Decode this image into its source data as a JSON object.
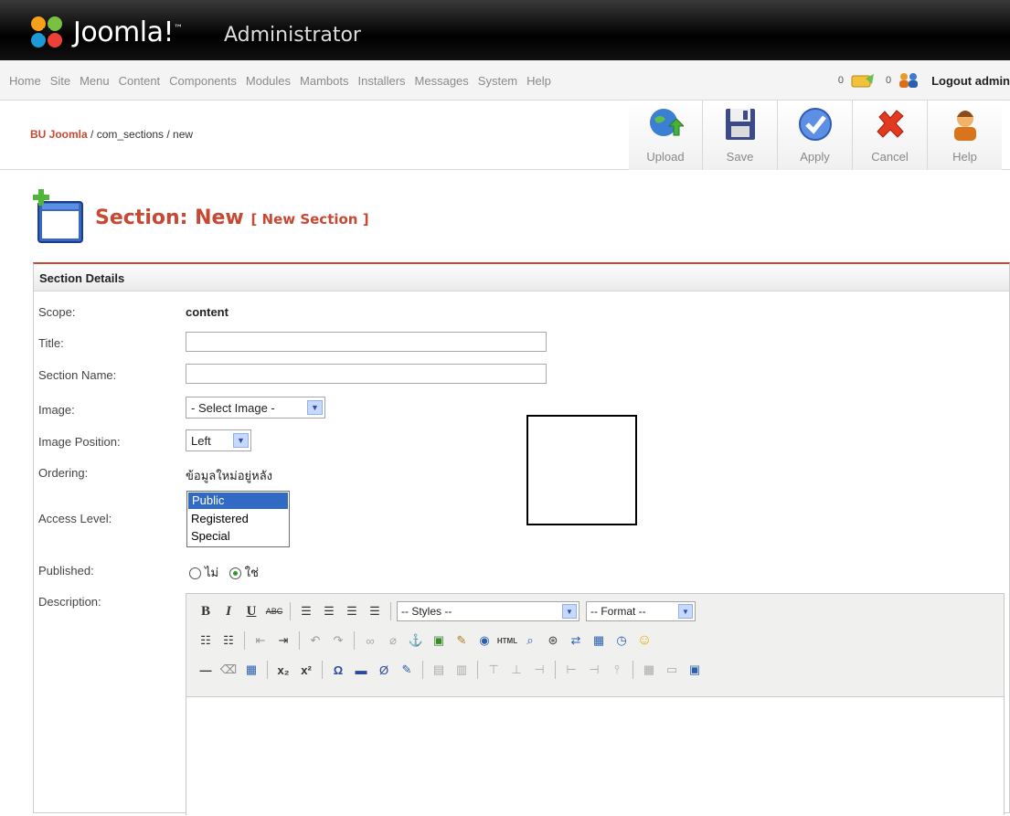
{
  "header": {
    "logo": "Joomla!",
    "tm": "™",
    "subtitle": "Administrator"
  },
  "menu": {
    "items": [
      "Home",
      "Site",
      "Menu",
      "Content",
      "Components",
      "Modules",
      "Mambots",
      "Installers",
      "Messages",
      "System",
      "Help"
    ],
    "messages_count": "0",
    "users_count": "0",
    "logout": "Logout admin"
  },
  "breadcrumb": {
    "site": "BU Joomla",
    "path": " / com_sections / new"
  },
  "toolbar": {
    "upload": "Upload",
    "save": "Save",
    "apply": "Apply",
    "cancel": "Cancel",
    "help": "Help"
  },
  "page": {
    "title": "Section: New",
    "subtitle": "[ New Section ]"
  },
  "form": {
    "heading": "Section Details",
    "scope_label": "Scope:",
    "scope_value": "content",
    "title_label": "Title:",
    "title_value": "",
    "name_label": "Section Name:",
    "name_value": "",
    "image_label": "Image:",
    "image_value": "- Select Image -",
    "image_pos_label": "Image Position:",
    "image_pos_value": "Left",
    "ordering_label": "Ordering:",
    "ordering_value": "ข้อมูลใหม่อยู่หลัง",
    "access_label": "Access Level:",
    "access_options": [
      "Public",
      "Registered",
      "Special"
    ],
    "access_selected": "Public",
    "published_label": "Published:",
    "published_no": "ไม่",
    "published_yes": "ใช่",
    "published_selected": "ใช่",
    "description_label": "Description:"
  },
  "editor": {
    "styles": "-- Styles --",
    "format": "-- Format --"
  }
}
